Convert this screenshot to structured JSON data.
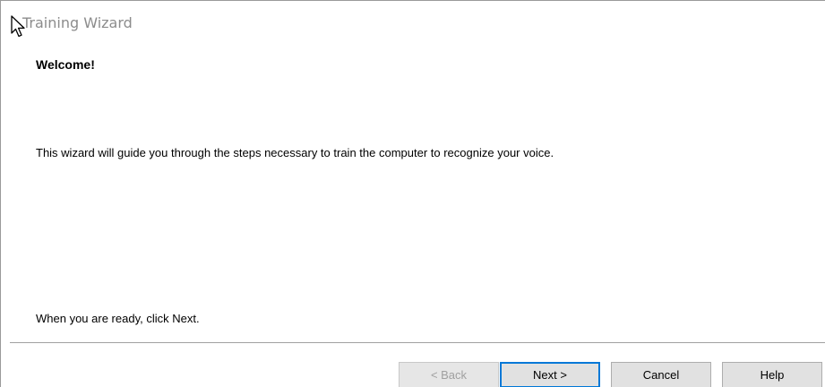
{
  "window": {
    "title": "Training Wizard"
  },
  "content": {
    "heading": "Welcome!",
    "description": "This wizard will guide you through the steps necessary to train the computer to recognize your voice.",
    "instruction": "When you are ready, click Next."
  },
  "buttons": {
    "back": "< Back",
    "next": "Next >",
    "cancel": "Cancel",
    "help": "Help"
  },
  "state": {
    "back_enabled": false,
    "default_button": "next"
  },
  "colors": {
    "title_text": "#8c8c8c",
    "button_face": "#e1e1e1",
    "default_focus_border": "#0078d7",
    "disabled_text": "#a0a0a0"
  }
}
